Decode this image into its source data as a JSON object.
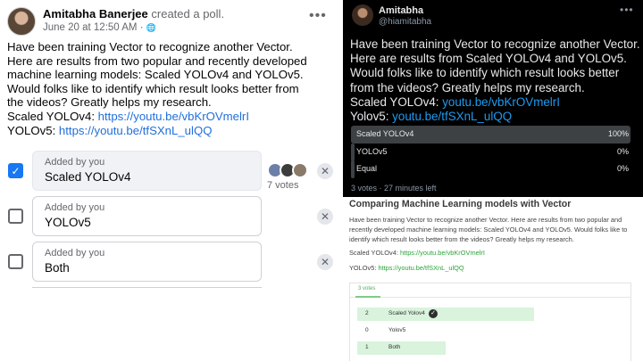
{
  "facebook": {
    "author": "Amitabha Banerjee",
    "action": "created a poll.",
    "date": "June 20 at 12:50 AM",
    "audience_icon": "globe-icon",
    "more_icon": "more-options-icon",
    "post_text": "Have been training Vector to recognize another Vector. Here are results from two popular and recently developed machine learning models: Scaled YOLOv4 and YOLOv5. Would folks like to identify which result looks better from the videos? Greatly helps my research.",
    "line_v4_label": "Scaled YOLOv4:",
    "line_v4_url": "https://youtu.be/vbKrOVmelrI",
    "line_v5_label": "YOLOv5:",
    "line_v5_url": "https://youtu.be/tfSXnL_ulQQ",
    "options": [
      {
        "added": "Added by you",
        "label": "Scaled YOLOv4",
        "checked": true
      },
      {
        "added": "Added by you",
        "label": "YOLOv5",
        "checked": false
      },
      {
        "added": "Added by you",
        "label": "Both",
        "checked": false
      }
    ],
    "votes": "7 votes",
    "check_mark": "✓",
    "remove_glyph": "✕",
    "more_glyph": "•••",
    "globe_glyph": "🌐"
  },
  "twitter": {
    "name": "Amitabha",
    "handle": "@hiamitabha",
    "more_glyph": "•••",
    "tweet_text": "Have been training Vector to recognize another Vector. Here are results from Scaled YOLOv4 and YOLOv5. Would folks like to identify which result looks better from the videos? Greatly helps my research.",
    "line_v4_label": "Scaled YOLOv4:",
    "line_v4_url": "youtu.be/vbKrOVmelrI",
    "line_v5_label": "Yolov5:",
    "line_v5_url": "youtu.be/tfSXnL_ulQQ",
    "poll": [
      {
        "label": "Scaled YOLOv4",
        "percent": "100%",
        "value": 1.0
      },
      {
        "label": "YOLOv5",
        "percent": "0%",
        "value": 0
      },
      {
        "label": "Equal",
        "percent": "0%",
        "value": 0
      }
    ],
    "poll_meta": "3 votes · 27 minutes left"
  },
  "blog": {
    "title": "Comparing Machine Learning models with Vector",
    "description": "Have been training Vector to recognize another Vector. Here are results from two popular and recently developed machine learning models: Scaled YOLOv4 and YOLOv5. Would folks like to identify which result looks better from the videos? Greatly helps my research.",
    "line_v4_label": "Scaled YOLOv4:",
    "line_v4_url": "https://youtu.be/vbKrOVmelrI",
    "line_v5_label": "YOLOv5:",
    "line_v5_url": "https://youtu.be/tfSXnL_ulQQ",
    "tab": "3 votes",
    "rows": [
      {
        "count": "2",
        "label": "Scaled Yolov4",
        "value": 2,
        "winner": true
      },
      {
        "count": "0",
        "label": "Yolov5",
        "value": 0,
        "winner": false
      },
      {
        "count": "1",
        "label": "Both",
        "value": 1,
        "winner": false
      }
    ],
    "check_glyph": "✓",
    "accent_color": "#d9f3dc"
  }
}
